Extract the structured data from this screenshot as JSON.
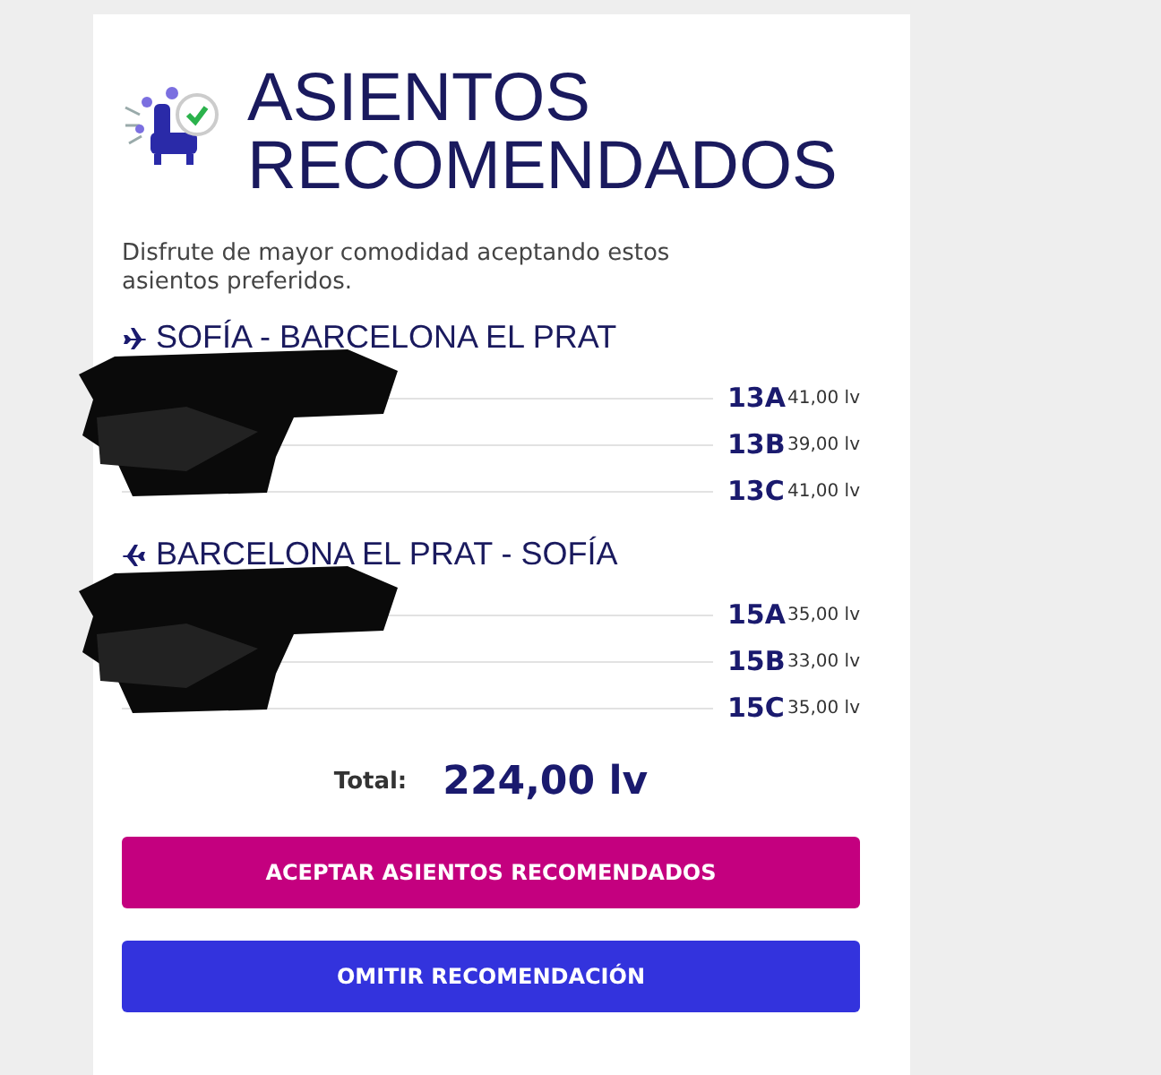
{
  "title": [
    "ASIENTOS",
    "RECOMENDADOS"
  ],
  "description": "Disfrute de mayor comodidad aceptando estos asientos preferidos.",
  "flights": [
    {
      "route": "SOFÍA - BARCELONA EL PRAT",
      "seats": [
        {
          "seat": "13A",
          "price": "41,00 lv"
        },
        {
          "seat": "13B",
          "price": "39,00 lv"
        },
        {
          "seat": "13C",
          "price": "41,00 lv"
        }
      ]
    },
    {
      "route": "BARCELONA EL PRAT - SOFÍA",
      "seats": [
        {
          "seat": "15A",
          "price": "35,00 lv"
        },
        {
          "seat": "15B",
          "price": "33,00 lv"
        },
        {
          "seat": "15C",
          "price": "35,00 lv"
        }
      ]
    }
  ],
  "total": {
    "label": "Total:",
    "value": "224,00 lv"
  },
  "buttons": [
    {
      "label": "ACEPTAR ASIENTOS RECOMENDADOS",
      "kind": "primary"
    },
    {
      "label": "OMITIR RECOMENDACIÓN",
      "kind": "secondary"
    }
  ]
}
